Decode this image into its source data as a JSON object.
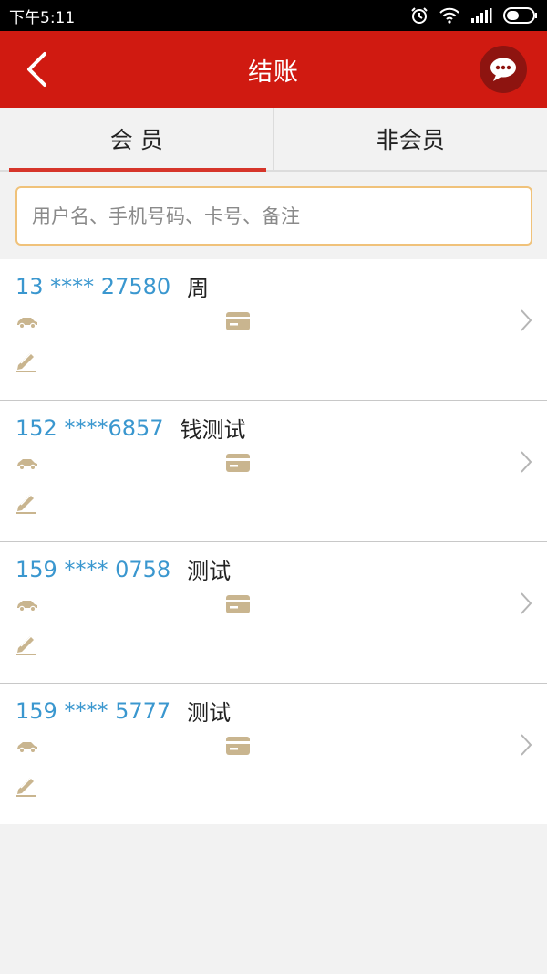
{
  "status_bar": {
    "time": "下午5:11"
  },
  "header": {
    "title": "结账",
    "back_icon": "chevron-left-icon",
    "chat_icon": "chat-bubble-icon"
  },
  "tabs": [
    {
      "label": "会 员",
      "active": true
    },
    {
      "label": "非会员",
      "active": false
    }
  ],
  "search": {
    "placeholder": "用户名、手机号码、卡号、备注",
    "value": ""
  },
  "members": [
    {
      "phone": "13 **** 27580",
      "name": "周"
    },
    {
      "phone": "152 ****6857",
      "name": "钱测试"
    },
    {
      "phone": "159 **** 0758",
      "name": "测试"
    },
    {
      "phone": "159 **** 5777",
      "name": "测试"
    }
  ],
  "colors": {
    "accent": "#d01a11",
    "phone": "#3a97cf",
    "icon": "#c9b58f"
  }
}
